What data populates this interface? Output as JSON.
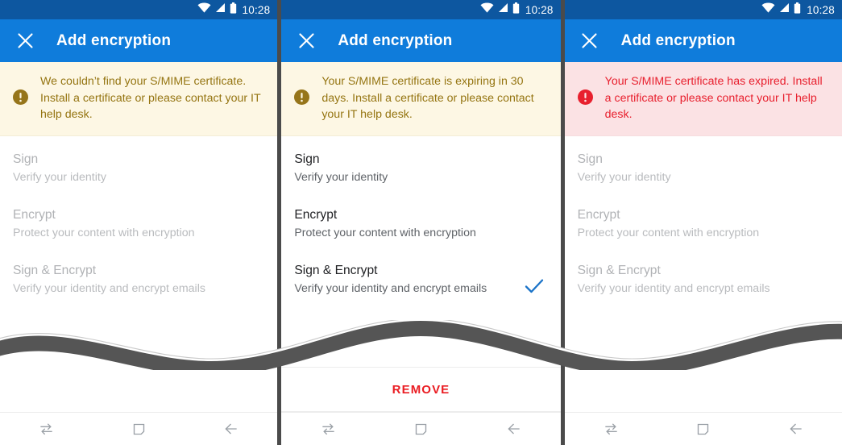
{
  "statusbar": {
    "time": "10:28",
    "icons": [
      "wifi-icon",
      "signal-icon",
      "battery-icon"
    ]
  },
  "appbar": {
    "title": "Add encryption",
    "close_icon": "close-icon"
  },
  "colors": {
    "status_bar": "#0d57a0",
    "app_bar": "#0f7cdb",
    "warning_bg": "#fdf7e4",
    "warning_text": "#957512",
    "error_bg": "#fbe2e4",
    "error_text": "#e8202e",
    "check_blue": "#1a73c8",
    "remove_red": "#ea1c22",
    "title_enabled": "#202124",
    "subtitle": "#5f6368",
    "title_disabled": "#b0b2b5"
  },
  "options": [
    {
      "title": "Sign",
      "subtitle": "Verify your identity"
    },
    {
      "title": "Encrypt",
      "subtitle": "Protect your content with encryption"
    },
    {
      "title": "Sign & Encrypt",
      "subtitle": "Verify your identity and encrypt emails"
    }
  ],
  "panels": [
    {
      "id": "missing-certificate",
      "banner": {
        "severity": "warning",
        "icon": "warning-circle-icon",
        "message": "We couldn’t find your S/MIME certificate. Install a certificate or please contact your IT help desk."
      },
      "options_enabled": false,
      "selected_index": null,
      "has_remove_button": false
    },
    {
      "id": "expiring-certificate",
      "banner": {
        "severity": "warning",
        "icon": "warning-circle-icon",
        "message": "Your S/MIME certificate is expiring in 30 days. Install a certificate or please contact your IT help desk."
      },
      "options_enabled": true,
      "selected_index": 2,
      "has_remove_button": true,
      "remove_label": "REMOVE"
    },
    {
      "id": "expired-certificate",
      "banner": {
        "severity": "error",
        "icon": "error-circle-icon",
        "message": "Your S/MIME certificate has expired. Install a certificate or please contact your IT help desk."
      },
      "options_enabled": false,
      "selected_index": null,
      "has_remove_button": false
    }
  ],
  "navbar": {
    "buttons": [
      {
        "icon": "recent-apps-icon",
        "label": "Recents"
      },
      {
        "icon": "home-square-icon",
        "label": "Home"
      },
      {
        "icon": "back-arrow-icon",
        "label": "Back"
      }
    ]
  }
}
